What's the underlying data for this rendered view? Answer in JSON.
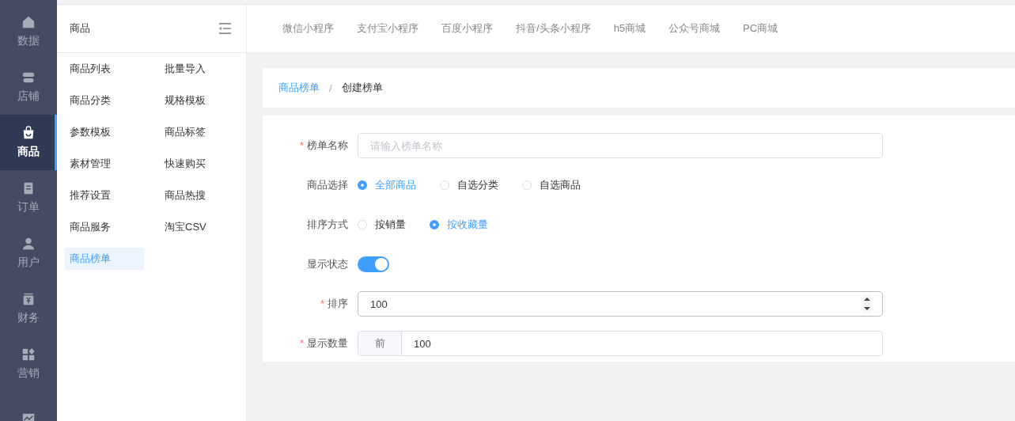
{
  "rail": [
    {
      "label": "数据",
      "selected": false
    },
    {
      "label": "店铺",
      "selected": false
    },
    {
      "label": "商品",
      "selected": true
    },
    {
      "label": "订单",
      "selected": false
    },
    {
      "label": "用户",
      "selected": false
    },
    {
      "label": "财务",
      "selected": false
    },
    {
      "label": "营销",
      "selected": false
    },
    {
      "selected": false
    }
  ],
  "submenu": {
    "title": "商品",
    "items": [
      {
        "label": "商品列表",
        "selected": false
      },
      {
        "label": "批量导入",
        "selected": false
      },
      {
        "label": "商品分类",
        "selected": false
      },
      {
        "label": "规格模板",
        "selected": false
      },
      {
        "label": "参数模板",
        "selected": false
      },
      {
        "label": "商品标签",
        "selected": false
      },
      {
        "label": "素材管理",
        "selected": false
      },
      {
        "label": "快速购买",
        "selected": false
      },
      {
        "label": "推荐设置",
        "selected": false
      },
      {
        "label": "商品热搜",
        "selected": false
      },
      {
        "label": "商品服务",
        "selected": false
      },
      {
        "label": "淘宝CSV",
        "selected": false
      },
      {
        "label": "商品榜单",
        "selected": true
      }
    ]
  },
  "tabs": [
    "微信小程序",
    "支付宝小程序",
    "百度小程序",
    "抖音/头条小程序",
    "h5商城",
    "公众号商城",
    "PC商城"
  ],
  "breadcrumb": {
    "items": [
      "商品榜单",
      "创建榜单"
    ],
    "separator": "/"
  },
  "form": [
    {
      "kind": "text",
      "label": "榜单名称",
      "required_mark": "*",
      "placeholder": "请输入榜单名称"
    },
    {
      "kind": "radio",
      "label": "商品选择",
      "options": [
        {
          "label": "全部商品",
          "selected": true
        },
        {
          "label": "自选分类",
          "selected": false
        },
        {
          "label": "自选商品",
          "selected": false
        }
      ]
    },
    {
      "kind": "radio",
      "label": "排序方式",
      "options": [
        {
          "label": "按销量",
          "selected": false
        },
        {
          "label": "按收藏量",
          "selected": true
        }
      ]
    },
    {
      "kind": "switch",
      "label": "显示状态",
      "on": true
    },
    {
      "kind": "number",
      "label": "排序",
      "required_mark": "*",
      "value": "100"
    },
    {
      "kind": "prefixed",
      "label": "显示数量",
      "required_mark": "*",
      "prefix": "前",
      "value": "100"
    }
  ]
}
